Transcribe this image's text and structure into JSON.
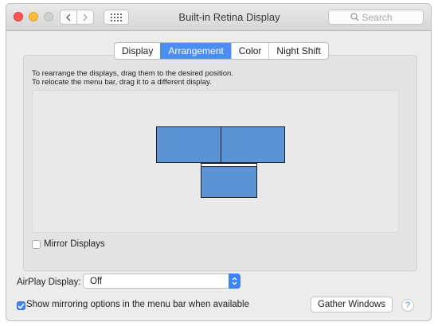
{
  "window": {
    "title": "Built-in Retina Display",
    "back_icon": "chevron-left-icon",
    "forward_icon": "chevron-right-icon",
    "grid_icon": "grid-icon"
  },
  "search": {
    "placeholder": "Search",
    "icon": "search-icon"
  },
  "tabs": [
    {
      "label": "Display",
      "active": false
    },
    {
      "label": "Arrangement",
      "active": true
    },
    {
      "label": "Color",
      "active": false
    },
    {
      "label": "Night Shift",
      "active": false
    }
  ],
  "arrangement": {
    "instruction_1": "To rearrange the displays, drag them to the desired position.",
    "instruction_2": "To relocate the menu bar, drag it to a different display.",
    "displays": [
      "display-left",
      "display-right",
      "display-main"
    ],
    "display_color": "#5c93d4"
  },
  "mirror_displays": {
    "label": "Mirror Displays",
    "checked": false
  },
  "airplay": {
    "label": "AirPlay Display:",
    "value": "Off"
  },
  "mirroring_menu": {
    "label": "Show mirroring options in the menu bar when available",
    "checked": true
  },
  "gather_button": "Gather Windows",
  "help_button": "?",
  "colors": {
    "accent": "#3d84f0",
    "window_bg": "#ececec"
  }
}
